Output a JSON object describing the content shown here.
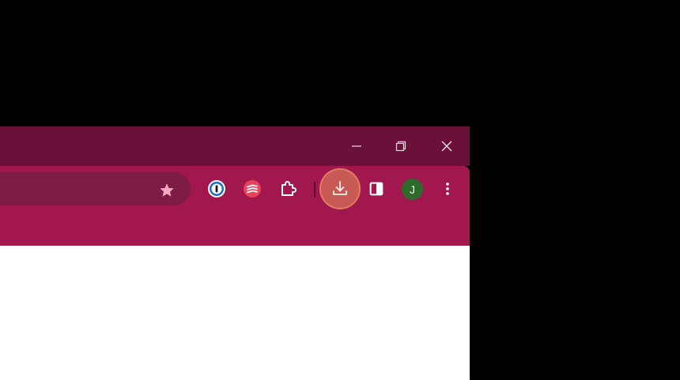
{
  "colors": {
    "background": "#000000",
    "titlebar": "#6b1038",
    "toolbar": "#a3174f",
    "omnibox": "#7e1c44",
    "download_highlight": "#c85a55",
    "avatar": "#2e6b2a",
    "content": "#ffffff"
  },
  "window_controls": {
    "minimize_icon": "minimize-icon",
    "restore_icon": "restore-icon",
    "close_icon": "close-icon"
  },
  "omnibox": {
    "bookmark_icon": "star-icon"
  },
  "toolbar": {
    "extensions": [
      {
        "name": "1password-extension",
        "icon": "1password-icon"
      },
      {
        "name": "todoist-extension",
        "icon": "todoist-icon"
      },
      {
        "name": "extensions-menu",
        "icon": "puzzle-icon"
      }
    ],
    "download_icon": "download-icon",
    "side_panel_icon": "side-panel-icon",
    "profile_initial": "J",
    "menu_icon": "more-vert-icon"
  }
}
